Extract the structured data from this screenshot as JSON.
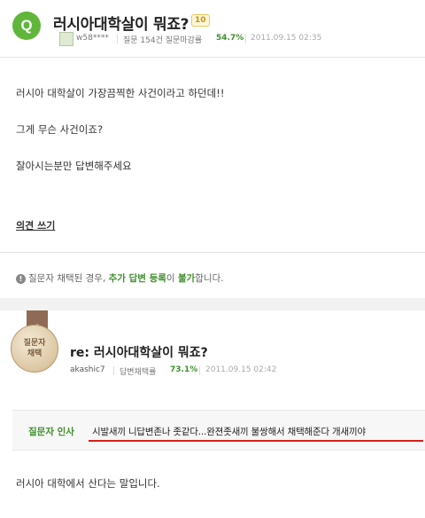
{
  "question": {
    "badge": "Q",
    "title": "러시아대학살이 뭐죠?",
    "points": "10",
    "author": "w58****",
    "stats_label": "질문 154건 질문마감률",
    "close_rate": "54.7%",
    "datetime": "2011.09.15 02:35",
    "body": [
      "러시아 대학살이 가장끔찍한 사건이라고 하던데!!",
      "그게 무슨 사건이죠?",
      "잘아시는분만 답변해주세요"
    ]
  },
  "opinion_link": "의견 쓰기",
  "notice": {
    "prefix": "질문자 채택된 경우,",
    "highlight1": "추가 답변 등록",
    "middle": "이",
    "highlight2": "불가",
    "suffix": "합니다."
  },
  "answer": {
    "medal_line1": "질문자",
    "medal_line2": "채택",
    "title": "re: 러시아대학살이 뭐죠?",
    "author": "akashic7",
    "adopt_label": "답변채택률",
    "adopt_rate": "73.1%",
    "datetime": "2011.09.15 02:42",
    "greeting_label": "질문자 인사",
    "greeting_text": "시발새끼 니답변존나 좃같다...완젼좃새끼 불쌍해서 채택해준다 개새끼야",
    "body": "러시아 대학에서 산다는 말입니다."
  }
}
